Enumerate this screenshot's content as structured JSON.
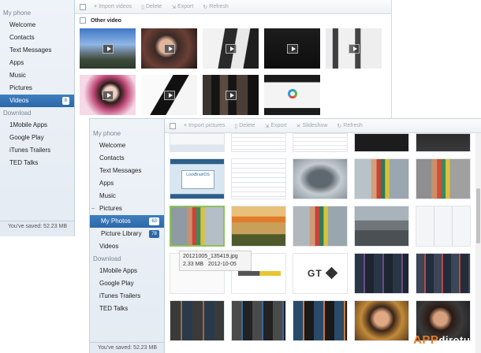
{
  "back_window": {
    "sidebar": {
      "phone_header": "My phone",
      "items": [
        {
          "label": "Welcome"
        },
        {
          "label": "Contacts"
        },
        {
          "label": "Text Messages"
        },
        {
          "label": "Apps"
        },
        {
          "label": "Music"
        },
        {
          "label": "Pictures"
        },
        {
          "label": "Videos",
          "count": "8"
        }
      ],
      "download_header": "Download",
      "download_items": [
        {
          "label": "1Mobile Apps"
        },
        {
          "label": "Google Play"
        },
        {
          "label": "iTunes Trailers"
        },
        {
          "label": "TED Talks"
        }
      ],
      "saved": "You've saved: 52.23 MB"
    },
    "toolbar": {
      "import": "Import videos",
      "delete": "Delete",
      "export": "Export",
      "refresh": "Refresh"
    },
    "group_title": "Other video"
  },
  "front_window": {
    "sidebar": {
      "phone_header": "My phone",
      "items": [
        {
          "label": "Welcome"
        },
        {
          "label": "Contacts"
        },
        {
          "label": "Text Messages"
        },
        {
          "label": "Apps"
        },
        {
          "label": "Music"
        },
        {
          "label": "Pictures"
        }
      ],
      "sub_items": [
        {
          "label": "My Photos",
          "count": "63"
        },
        {
          "label": "Picture Library",
          "count": "78"
        }
      ],
      "videos": "Videos",
      "download_header": "Download",
      "download_items": [
        {
          "label": "1Mobile Apps"
        },
        {
          "label": "Google Play"
        },
        {
          "label": "iTunes Trailers"
        },
        {
          "label": "TED Talks"
        }
      ],
      "saved": "You've saved: 52.23 MB"
    },
    "toolbar": {
      "import": "Import pictures",
      "delete": "Delete",
      "export": "Export",
      "slideshow": "Slideshow",
      "refresh": "Refresh"
    },
    "tooltip": {
      "filename": "20121005_135419.jpg",
      "size": "2.33 MB",
      "date": "2012-10-05"
    },
    "thumb_texts": {
      "gt_logo": "GT",
      "dialog_link": "LockBrainOS"
    }
  },
  "watermark": {
    "brand": "APP",
    "suffix": "dirotus"
  },
  "colors": {
    "accent": "#2c68a8",
    "selection": "#8cc35a",
    "import_green": "#5cb832",
    "watermark": "#e37b28"
  },
  "icons": {
    "import": "plus-icon",
    "delete": "trash-icon",
    "export": "export-icon",
    "slideshow": "slideshow-icon",
    "refresh": "refresh-icon",
    "video": "play-icon"
  }
}
